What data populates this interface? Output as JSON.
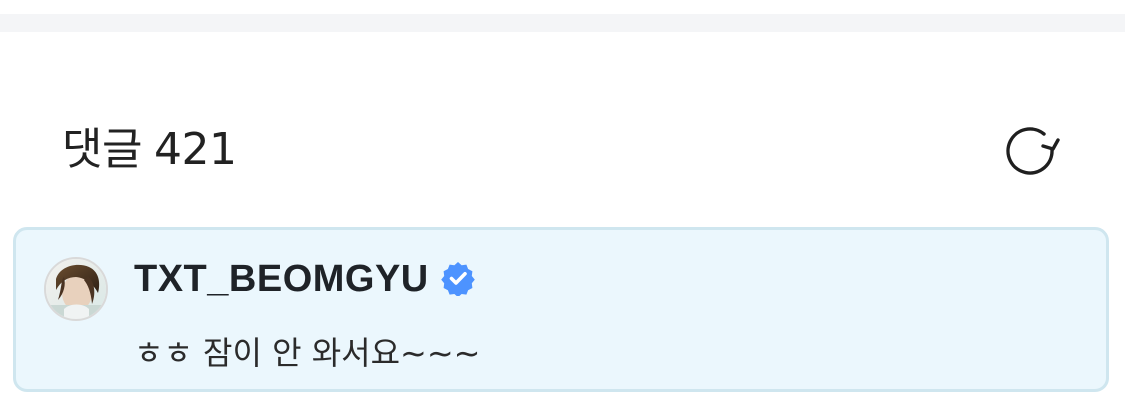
{
  "header": {
    "title": "댓글",
    "count": "421",
    "refresh_icon": "refresh-icon"
  },
  "comment": {
    "username": "TXT_BEOMGYU",
    "verified_icon": "verified-badge-icon",
    "text": "ㅎㅎ 잠이 안 와서요~~~",
    "avatar_icon": "avatar"
  },
  "colors": {
    "top_band": "#f4f5f7",
    "card_background": "#ebf7fd",
    "card_border": "#cfe6ef",
    "verified_blue": "#4d93ff",
    "text_primary": "#222222"
  }
}
